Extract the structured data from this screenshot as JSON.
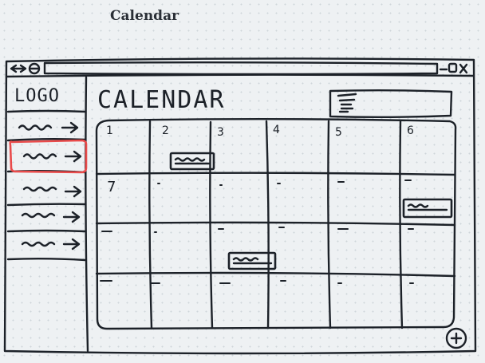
{
  "page": {
    "title": "Calendar"
  },
  "window": {},
  "sidebar": {
    "logo": "LOGO",
    "items": [
      {
        "active": false
      },
      {
        "active": true
      },
      {
        "active": false
      },
      {
        "active": false
      },
      {
        "active": false
      }
    ],
    "active_color": "#e94b4b"
  },
  "main": {
    "title": "CALENDAR",
    "day_numbers": [
      "1",
      "2",
      "3",
      "4",
      "5",
      "6",
      "7"
    ]
  },
  "colors": {
    "ink": "#1c2128",
    "highlight": "#e94b4b",
    "background": "#eef1f3"
  }
}
